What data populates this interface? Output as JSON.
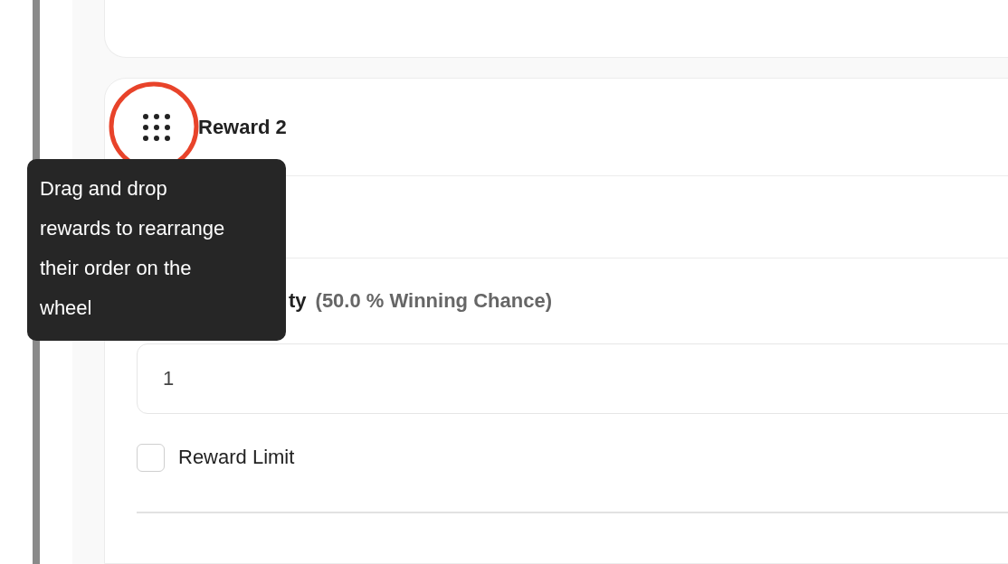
{
  "reward": {
    "title": "Reward 2",
    "probability_label": "ty",
    "winning_chance": "(50.0 % Winning Chance)",
    "quantity": "1",
    "reward_limit": {
      "label": "Reward Limit",
      "checked": false
    }
  },
  "tooltip": {
    "text": "Drag and drop rewards to rearrange their order on the wheel"
  }
}
